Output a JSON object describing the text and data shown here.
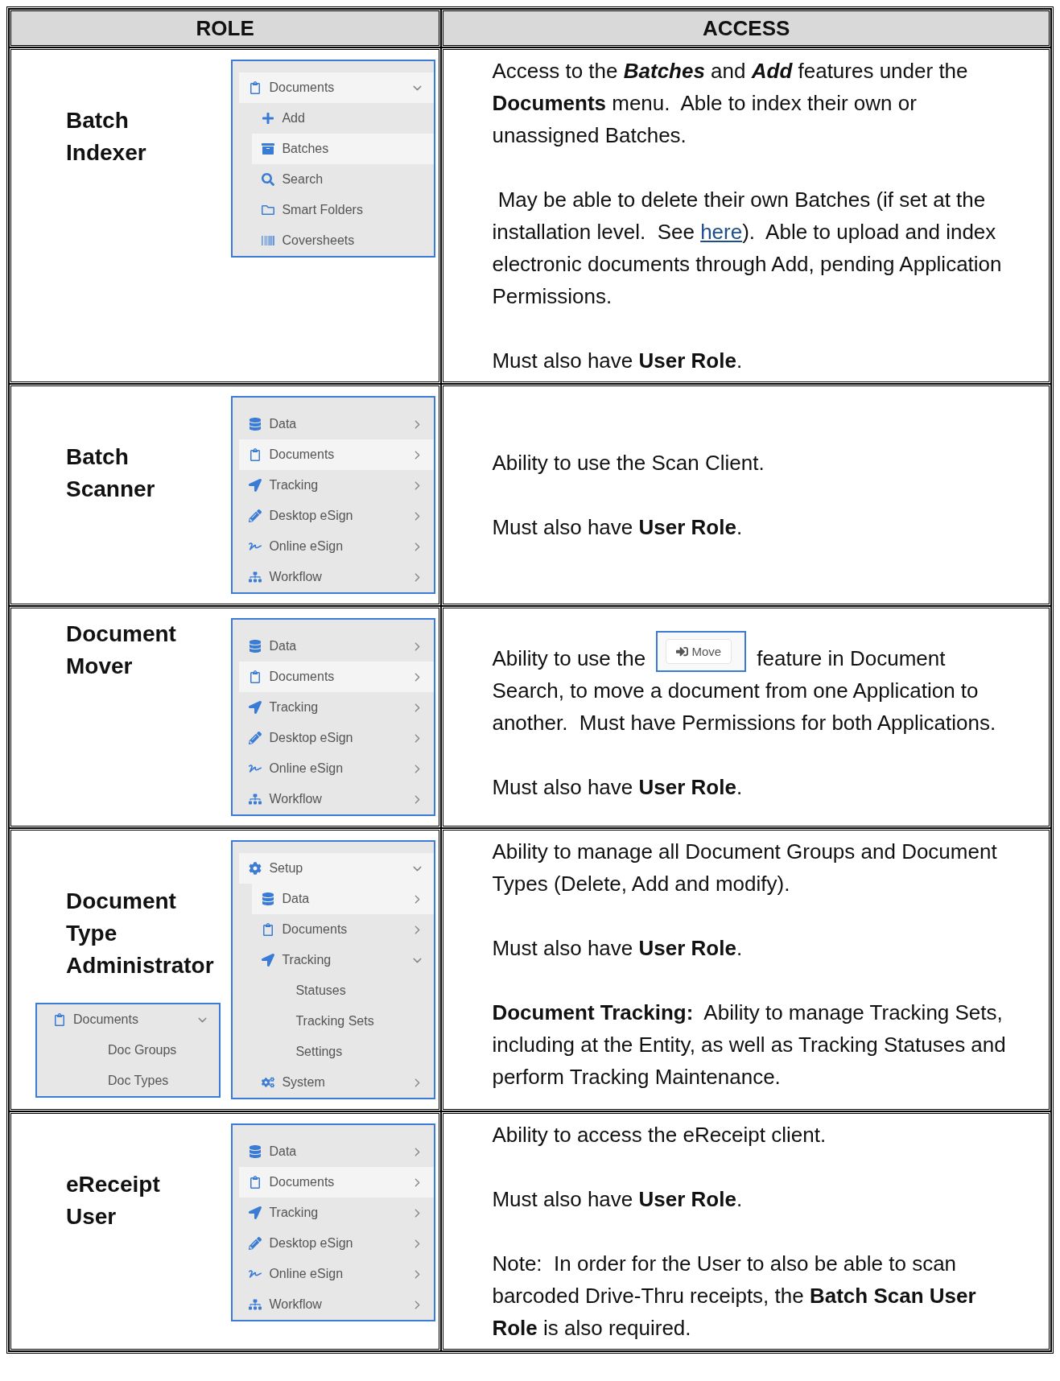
{
  "header": {
    "columns": [
      "ROLE",
      "ACCESS"
    ]
  },
  "roles": [
    {
      "name": "Batch Indexer",
      "menu": [
        {
          "label": "Documents",
          "kind": "clipboard",
          "selected": true,
          "expanded": true,
          "children": [
            {
              "label": "Add",
              "kind": "plus",
              "selected": false
            },
            {
              "label": "Batches",
              "kind": "archive",
              "selected": true
            },
            {
              "label": "Search",
              "kind": "search",
              "selected": false
            },
            {
              "label": "Smart Folders",
              "kind": "folder",
              "selected": false
            },
            {
              "label": "Coversheets",
              "kind": "barcode",
              "selected": false
            }
          ]
        }
      ],
      "access": [
        [
          {
            "kind": "text",
            "text": "Access to the "
          },
          {
            "kind": "emphasis",
            "text": "Batches"
          },
          {
            "kind": "text",
            "text": " and "
          },
          {
            "kind": "emphasis",
            "text": "Add"
          },
          {
            "kind": "text",
            "text": " features under the **Documents** menu.  Able to index their own or unassigned Batches."
          }
        ],
        [
          {
            "kind": "text",
            "text": " May be able to delete their own Batches (if set at the installation level.  See "
          },
          {
            "kind": "link",
            "text": "here"
          },
          {
            "kind": "text",
            "text": ").  Able to upload and index electronic documents through Add, pending Application Permissions."
          }
        ],
        [
          {
            "kind": "text",
            "text": "Must also have **User Role**."
          }
        ]
      ]
    },
    {
      "name": "Batch Scanner",
      "menu": [
        {
          "label": "Data",
          "kind": "database",
          "selected": false,
          "expanded": false
        },
        {
          "label": "Documents",
          "kind": "clipboard",
          "selected": true,
          "expanded": false
        },
        {
          "label": "Tracking",
          "kind": "arrow",
          "selected": false,
          "expanded": false
        },
        {
          "label": "Desktop eSign",
          "kind": "pencil",
          "selected": false,
          "expanded": false
        },
        {
          "label": "Online eSign",
          "kind": "signature",
          "selected": false,
          "expanded": false
        },
        {
          "label": "Workflow",
          "kind": "sitemap",
          "selected": false,
          "expanded": false
        }
      ],
      "access": [
        [
          {
            "kind": "text",
            "text": "Ability to use the Scan Client."
          }
        ],
        [
          {
            "kind": "text",
            "text": "Must also have **User Role**."
          }
        ]
      ]
    },
    {
      "name": "Document Mover",
      "menu": [
        {
          "label": "Data",
          "kind": "database",
          "selected": false,
          "expanded": false
        },
        {
          "label": "Documents",
          "kind": "clipboard",
          "selected": true,
          "expanded": false
        },
        {
          "label": "Tracking",
          "kind": "arrow",
          "selected": false,
          "expanded": false
        },
        {
          "label": "Desktop eSign",
          "kind": "pencil",
          "selected": false,
          "expanded": false
        },
        {
          "label": "Online eSign",
          "kind": "signature",
          "selected": false,
          "expanded": false
        },
        {
          "label": "Workflow",
          "kind": "sitemap",
          "selected": false,
          "expanded": false
        }
      ],
      "access": [
        [
          {
            "kind": "text",
            "text": "Ability to use the "
          },
          {
            "kind": "button",
            "text": "Move"
          },
          {
            "kind": "text",
            "text": " feature in Document Search, to move a document from one Application to another.  Must have Permissions for both Applications."
          }
        ],
        [
          {
            "kind": "text",
            "text": "Must also have **User Role**."
          }
        ]
      ]
    },
    {
      "name": "Document Type Administrator",
      "menu": [
        {
          "label": "Setup",
          "kind": "gear",
          "selected": true,
          "expanded": true,
          "children": [
            {
              "label": "Data",
              "kind": "database",
              "selected": true,
              "expanded": false
            },
            {
              "label": "Documents",
              "kind": "clipboard",
              "selected": false,
              "expanded": false
            },
            {
              "label": "Tracking",
              "kind": "arrow",
              "selected": false,
              "expanded": true,
              "children": [
                {
                  "label": "Statuses",
                  "selected": false
                },
                {
                  "label": "Tracking Sets",
                  "selected": false
                },
                {
                  "label": "Settings",
                  "selected": false
                }
              ]
            },
            {
              "label": "System",
              "kind": "gears",
              "selected": false,
              "expanded": false
            }
          ]
        }
      ],
      "second_menu": [
        {
          "label": "Documents",
          "kind": "clipboard",
          "selected": false,
          "expanded": true,
          "children": [
            {
              "label": "Doc Groups",
              "selected": false
            },
            {
              "label": "Doc Types",
              "selected": false
            }
          ]
        }
      ],
      "access": [
        [
          {
            "kind": "text",
            "text": "Ability to manage all Document Groups and Document Types (Delete, Add and modify)."
          }
        ],
        [
          {
            "kind": "text",
            "text": "Must also have **User Role**."
          }
        ],
        [
          {
            "kind": "text",
            "text": "**Document Tracking:**  Ability to manage Tracking Sets, including at the Entity, as well as Tracking Statuses and perform Tracking Maintenance."
          }
        ]
      ]
    },
    {
      "name": "eReceipt User",
      "menu": [
        {
          "label": "Data",
          "kind": "database",
          "selected": false,
          "expanded": false
        },
        {
          "label": "Documents",
          "kind": "clipboard",
          "selected": true,
          "expanded": false
        },
        {
          "label": "Tracking",
          "kind": "arrow",
          "selected": false,
          "expanded": false
        },
        {
          "label": "Desktop eSign",
          "kind": "pencil",
          "selected": false,
          "expanded": false
        },
        {
          "label": "Online eSign",
          "kind": "signature",
          "selected": false,
          "expanded": false
        },
        {
          "label": "Workflow",
          "kind": "sitemap",
          "selected": false,
          "expanded": false
        }
      ],
      "access": [
        [
          {
            "kind": "text",
            "text": "Ability to access the eReceipt client."
          }
        ],
        [
          {
            "kind": "text",
            "text": "Must also have **User Role**."
          }
        ],
        [
          {
            "kind": "text",
            "text": "Note:  In order for the User to also be able to scan barcoded Drive-Thru receipts, the **Batch Scan User Role** is also required."
          }
        ]
      ]
    }
  ]
}
